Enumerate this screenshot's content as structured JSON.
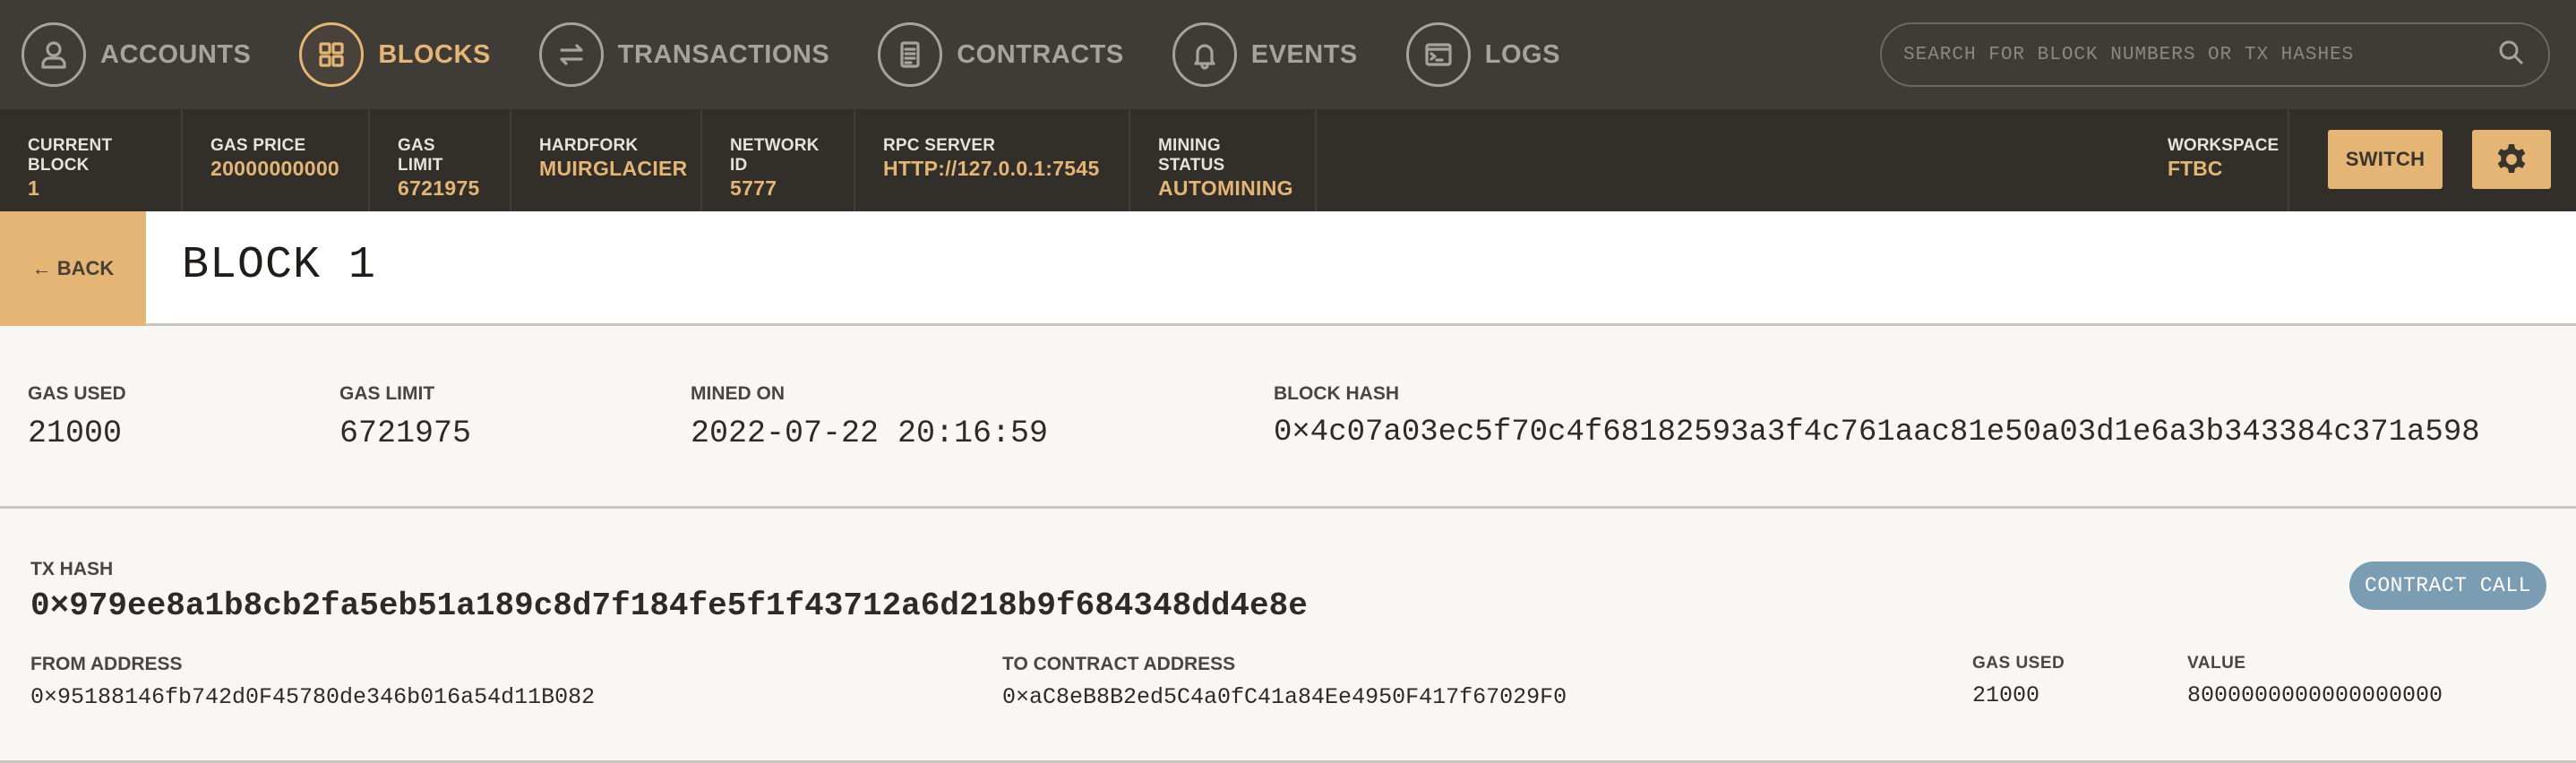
{
  "nav": {
    "items": [
      {
        "label": "ACCOUNTS",
        "icon": "person-icon",
        "active": false
      },
      {
        "label": "BLOCKS",
        "icon": "grid-icon",
        "active": true
      },
      {
        "label": "TRANSACTIONS",
        "icon": "swap-arrows-icon",
        "active": false
      },
      {
        "label": "CONTRACTS",
        "icon": "document-icon",
        "active": false
      },
      {
        "label": "EVENTS",
        "icon": "bell-icon",
        "active": false
      },
      {
        "label": "LOGS",
        "icon": "terminal-icon",
        "active": false
      }
    ],
    "search_placeholder": "SEARCH FOR BLOCK NUMBERS OR TX HASHES"
  },
  "status": {
    "current_block": {
      "label": "CURRENT BLOCK",
      "value": "1"
    },
    "gas_price": {
      "label": "GAS PRICE",
      "value": "20000000000"
    },
    "gas_limit": {
      "label": "GAS LIMIT",
      "value": "6721975"
    },
    "hardfork": {
      "label": "HARDFORK",
      "value": "MUIRGLACIER"
    },
    "network_id": {
      "label": "NETWORK ID",
      "value": "5777"
    },
    "rpc_server": {
      "label": "RPC SERVER",
      "value": "HTTP://127.0.0.1:7545"
    },
    "mining_status": {
      "label": "MINING STATUS",
      "value": "AUTOMINING"
    },
    "workspace": {
      "label": "WORKSPACE",
      "value": "FTBC"
    },
    "switch_label": "SWITCH"
  },
  "header": {
    "back_label": "← BACK",
    "title": "BLOCK 1"
  },
  "block": {
    "gas_used": {
      "label": "GAS USED",
      "value": "21000"
    },
    "gas_limit": {
      "label": "GAS LIMIT",
      "value": "6721975"
    },
    "mined_on": {
      "label": "MINED ON",
      "value": "2022-07-22 20:16:59"
    },
    "block_hash": {
      "label": "BLOCK HASH",
      "value": "0×4c07a03ec5f70c4f68182593a3f4c761aac81e50a03d1e6a3b343384c371a598"
    }
  },
  "transaction": {
    "tx_hash_label": "TX HASH",
    "tx_hash": "0×979ee8a1b8cb2fa5eb51a189c8d7f184fe5f1f43712a6d218b9f684348dd4e8e",
    "type_badge": "CONTRACT CALL",
    "from_label": "FROM ADDRESS",
    "from": "0×95188146fb742d0F45780de346b016a54d11B082",
    "to_label": "TO CONTRACT ADDRESS",
    "to": "0×aC8eB8B2ed5C4a0fC41a84Ee4950F417f67029F0",
    "gas_used_label": "GAS USED",
    "gas_used": "21000",
    "value_label": "VALUE",
    "value": "8000000000000000000"
  },
  "colors": {
    "accent": "#e4b574",
    "nav_bg": "#3f3b37",
    "status_bg": "#322f2b",
    "badge": "#7b9db3"
  }
}
